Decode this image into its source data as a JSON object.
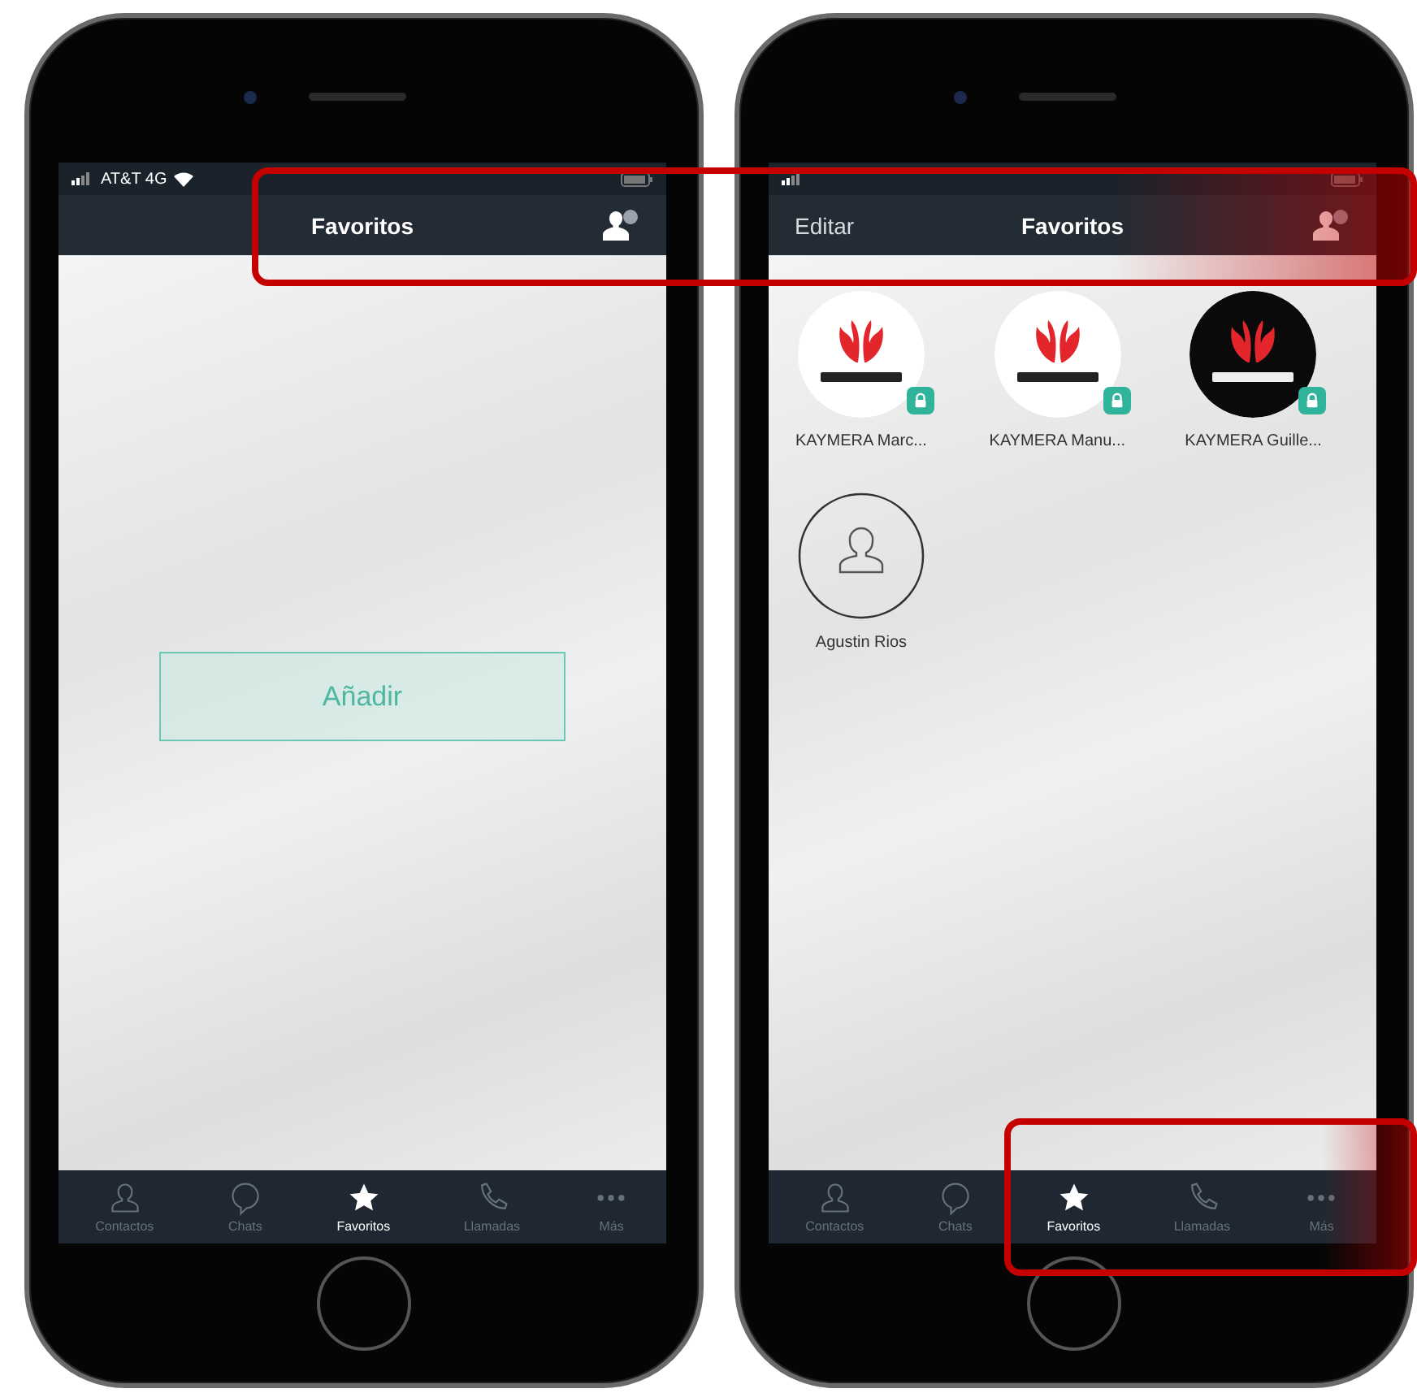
{
  "phones": [
    {
      "status_bar": {
        "carrier": "AT&T 4G"
      },
      "nav_bar": {
        "title": "Favoritos"
      },
      "content": {
        "kind": "empty",
        "button": "Añadir"
      },
      "tab_bar": [
        {
          "label": "Contactos",
          "selected": false
        },
        {
          "label": "Chats",
          "selected": false
        },
        {
          "label": "Favoritos",
          "selected": true
        },
        {
          "label": "Llamadas",
          "selected": false
        },
        {
          "label": "Más",
          "selected": false
        }
      ]
    },
    {
      "nav_bar": {
        "left_action": "Editar",
        "title": "Favoritos"
      },
      "content": {
        "kind": "grid",
        "favorites": [
          {
            "kind": "logo_light",
            "secure": true,
            "name": "KAYMERA Marc..."
          },
          {
            "kind": "logo_light",
            "secure": true,
            "name": "KAYMERA Manu..."
          },
          {
            "kind": "logo_dark",
            "secure": true,
            "name": "KAYMERA Guille..."
          },
          {
            "kind": "placeholder",
            "secure": false,
            "name": "Agustin  Rios"
          }
        ]
      },
      "tab_bar": [
        {
          "label": "Contactos",
          "selected": false
        },
        {
          "label": "Chats",
          "selected": false
        },
        {
          "label": "Favoritos",
          "selected": true
        },
        {
          "label": "Llamadas",
          "selected": false
        },
        {
          "label": "Más",
          "selected": false
        }
      ]
    }
  ]
}
